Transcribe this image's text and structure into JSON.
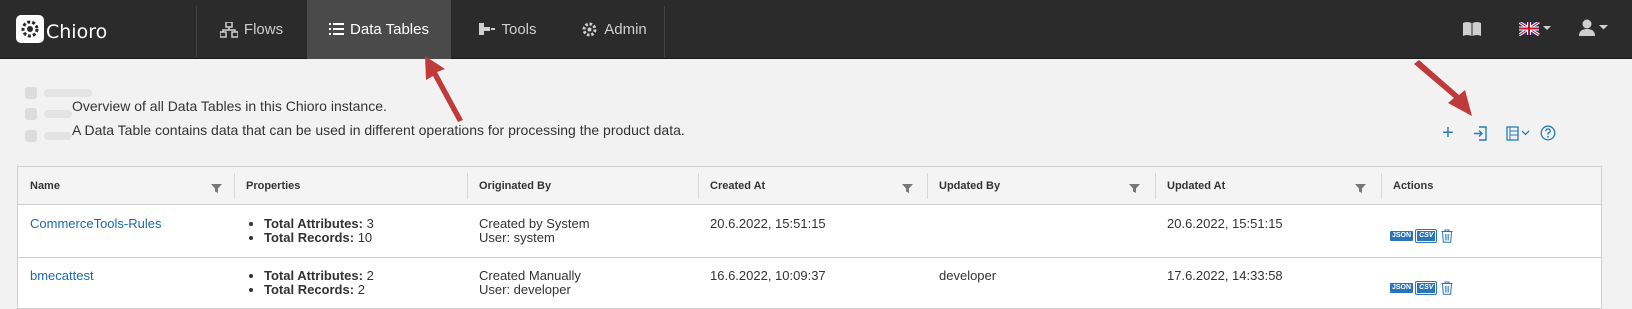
{
  "app": {
    "brand": "Chioro"
  },
  "nav": {
    "items": [
      {
        "label": "Flows",
        "icon": "flows-icon"
      },
      {
        "label": "Data Tables",
        "icon": "list-icon",
        "active": true
      },
      {
        "label": "Tools",
        "icon": "tools-icon"
      },
      {
        "label": "Admin",
        "icon": "gear-icon"
      }
    ],
    "right_icons": [
      "book-icon",
      "uk-flag-icon",
      "user-icon"
    ]
  },
  "description": {
    "line1": "Overview of all Data Tables in this Chioro instance.",
    "line2": "A Data Table contains data that can be used in different operations for processing the product data."
  },
  "toolbar": {
    "icons": [
      "add-icon",
      "import-icon",
      "columns-menu-icon",
      "help-icon"
    ],
    "add_symbol": "+"
  },
  "table": {
    "columns": [
      "Name",
      "Properties",
      "Originated By",
      "Created At",
      "Updated By",
      "Updated At",
      "Actions"
    ],
    "attr_label": "Total Attributes:",
    "records_label": "Total Records:",
    "badges": {
      "json": "JSON",
      "csv": "CSV"
    },
    "rows": [
      {
        "name": "CommerceTools-Rules",
        "total_attributes": "3",
        "total_records": "10",
        "originated_line1": "Created by System",
        "originated_line2": "User: system",
        "created_at": "20.6.2022, 15:51:15",
        "updated_by": "",
        "updated_at": "20.6.2022, 15:51:15"
      },
      {
        "name": "bmecattest",
        "total_attributes": "2",
        "total_records": "2",
        "originated_line1": "Created Manually",
        "originated_line2": "User: developer",
        "created_at": "16.6.2022, 10:09:37",
        "updated_by": "developer",
        "updated_at": "17.6.2022, 14:33:58"
      }
    ]
  },
  "colors": {
    "navbar": "#2b2b2b",
    "nav_active": "#4a4a4a",
    "link": "#1a68b5",
    "arrow": "#c0393b",
    "accent": "#2a74b8"
  }
}
